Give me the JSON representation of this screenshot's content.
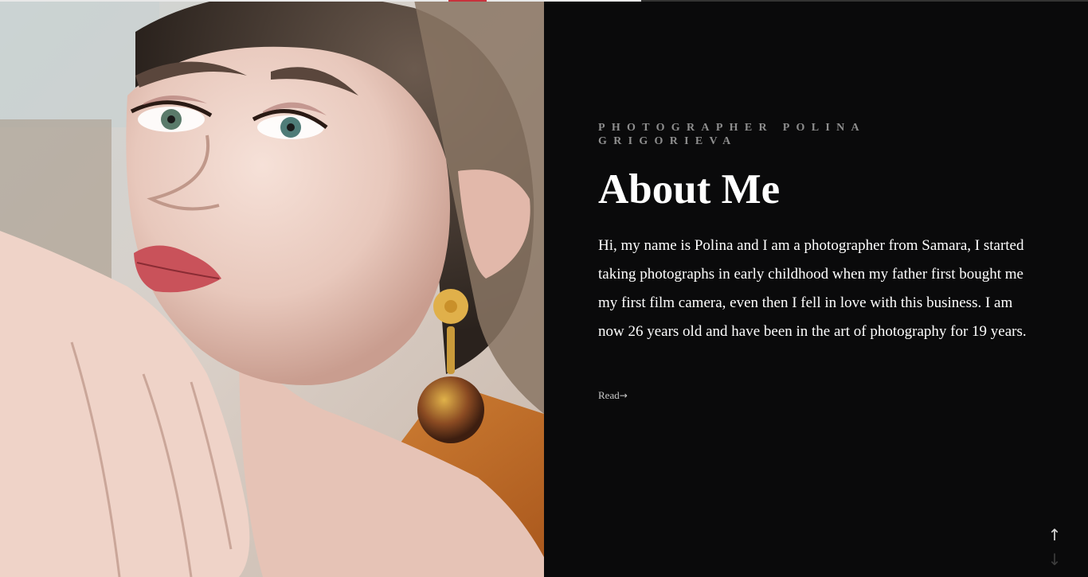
{
  "progress": {
    "fraction": 0.589,
    "accent_color": "#c8323c"
  },
  "hero_image": {
    "icon": "portrait-photo"
  },
  "about": {
    "kicker": "Photographer Polina Grigorieva",
    "title": "About Me",
    "bio": "Hi, my name is Polina and I am a photographer from Samara, I started taking photographs in early childhood when my father first bought me my first film camera, even then I fell in love with this business. I am now 26 years old and have been in the art of photography for 19 years.",
    "read_label": "Read",
    "read_arrow": "→"
  },
  "nav": {
    "up_arrow": "↑",
    "down_arrow": "↓"
  },
  "colors": {
    "background": "#0a0a0b",
    "text": "#ffffff",
    "kicker": "#8e8e8e"
  }
}
